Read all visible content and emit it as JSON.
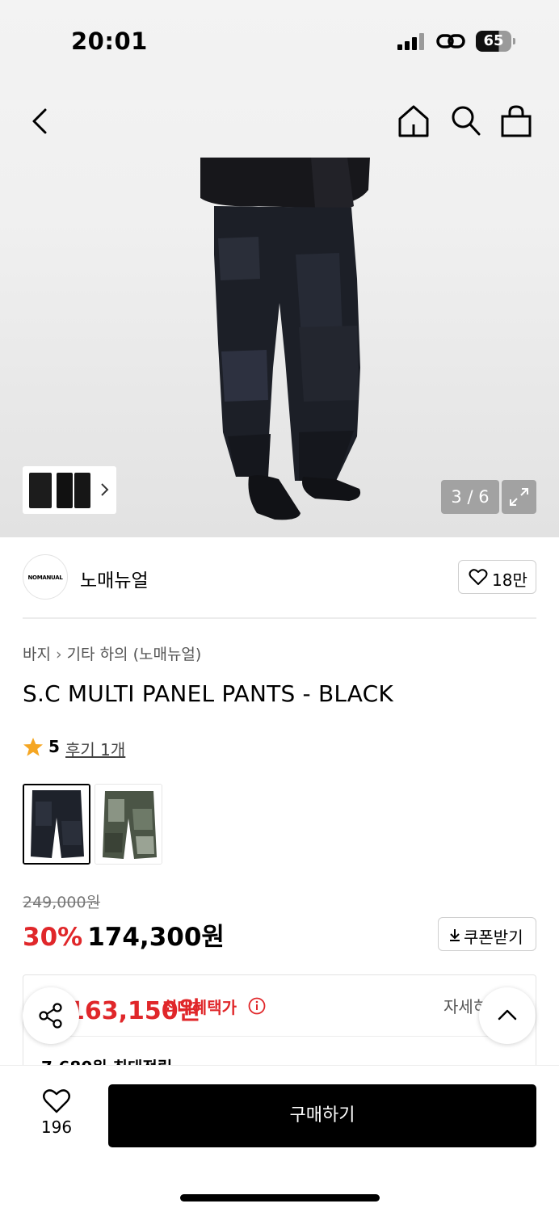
{
  "status_bar": {
    "time": "20:01",
    "battery": "65"
  },
  "nav": {
    "icons": [
      "back-arrow-icon",
      "home-icon",
      "search-icon",
      "shopping-bag-icon"
    ]
  },
  "gallery": {
    "counter": "3 / 6"
  },
  "brand": {
    "logo_text": "NOMANUAL",
    "name": "노매뉴얼",
    "likes": "18만"
  },
  "product": {
    "breadcrumb": [
      "바지",
      "기타 하의 (노매뉴얼)"
    ],
    "title": "S.C MULTI PANEL PANTS - BLACK",
    "rating": "5",
    "review_text": "후기 1개",
    "original_price": "249,000원",
    "discount": "30%",
    "price": "174,300원",
    "coupon_label": "쿠폰받기"
  },
  "benefit": {
    "price": "163,150원",
    "label": "최대혜택가",
    "detail_link": "자세히",
    "points": "7,680원 최대적립"
  },
  "bottom_bar": {
    "wish_count": "196",
    "buy_label": "구매하기"
  },
  "colors": {
    "accent_red": "#e0272a",
    "buy_button": "#000000"
  }
}
